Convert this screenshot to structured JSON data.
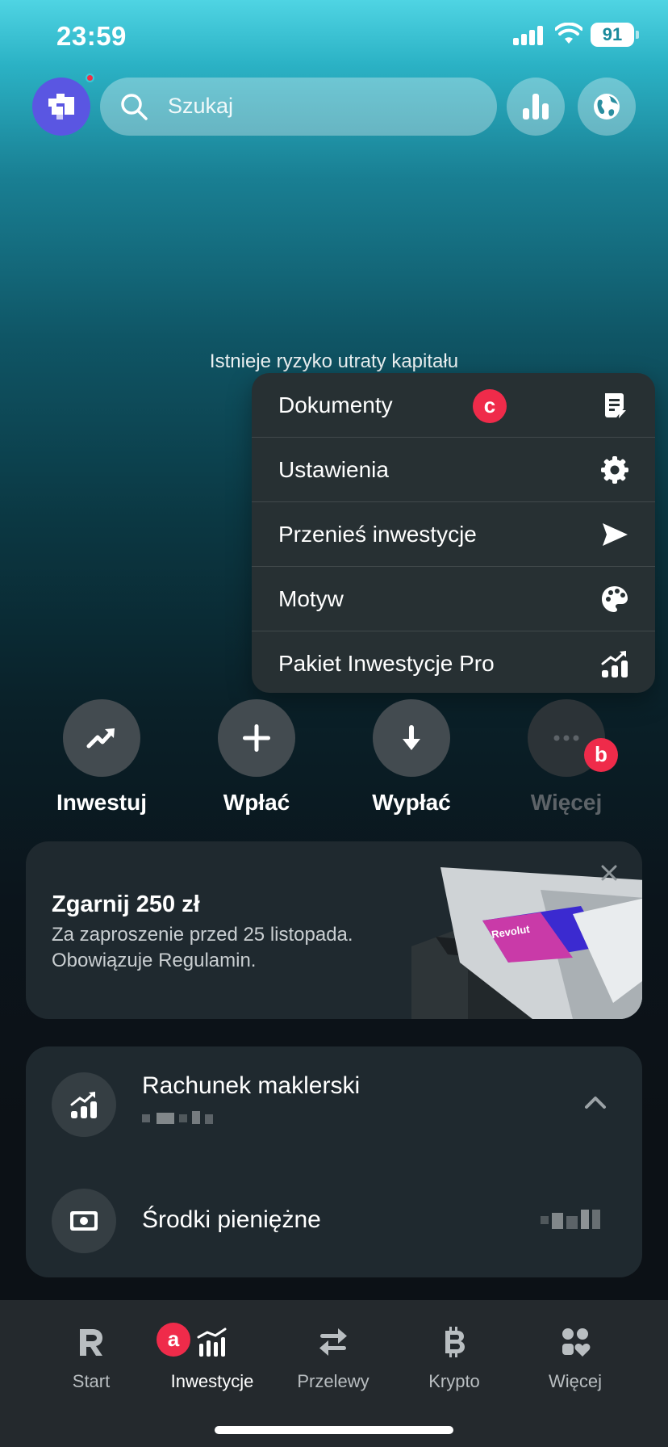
{
  "status_bar": {
    "time": "23:59",
    "battery": "91"
  },
  "header": {
    "search_placeholder": "Szukaj"
  },
  "risk_notice": "Istnieje ryzyko utraty kapitału",
  "menu": {
    "items": [
      {
        "label": "Dokumenty",
        "icon": "document-icon"
      },
      {
        "label": "Ustawienia",
        "icon": "gear-icon"
      },
      {
        "label": "Przenieś inwestycje",
        "icon": "send-icon"
      },
      {
        "label": "Motyw",
        "icon": "palette-icon"
      },
      {
        "label": "Pakiet Inwestycje Pro",
        "icon": "chart-up-icon"
      }
    ]
  },
  "markers": {
    "a": "a",
    "b": "b",
    "c": "c"
  },
  "actions": [
    {
      "label": "Inwestuj",
      "icon": "trend-up-icon"
    },
    {
      "label": "Wpłać",
      "icon": "plus-icon"
    },
    {
      "label": "Wypłać",
      "icon": "arrow-down-icon"
    },
    {
      "label": "Więcej",
      "icon": "more-icon"
    }
  ],
  "promo": {
    "title": "Zgarnij 250 zł",
    "text": "Za zaproszenie przed 25 listopada. Obowiązuje Regulamin.",
    "card_brand": "Revolut"
  },
  "account": {
    "brokerage_title": "Rachunek maklerski",
    "cash_title": "Środki pieniężne"
  },
  "tabs": [
    {
      "label": "Start",
      "icon": "revolut-r-icon"
    },
    {
      "label": "Inwestycje",
      "icon": "invest-bars-icon"
    },
    {
      "label": "Przelewy",
      "icon": "transfer-icon"
    },
    {
      "label": "Krypto",
      "icon": "bitcoin-icon"
    },
    {
      "label": "Więcej",
      "icon": "apps-icon"
    }
  ],
  "colors": {
    "accent_marker": "#ef2b4a",
    "avatar": "#5a56e2"
  }
}
